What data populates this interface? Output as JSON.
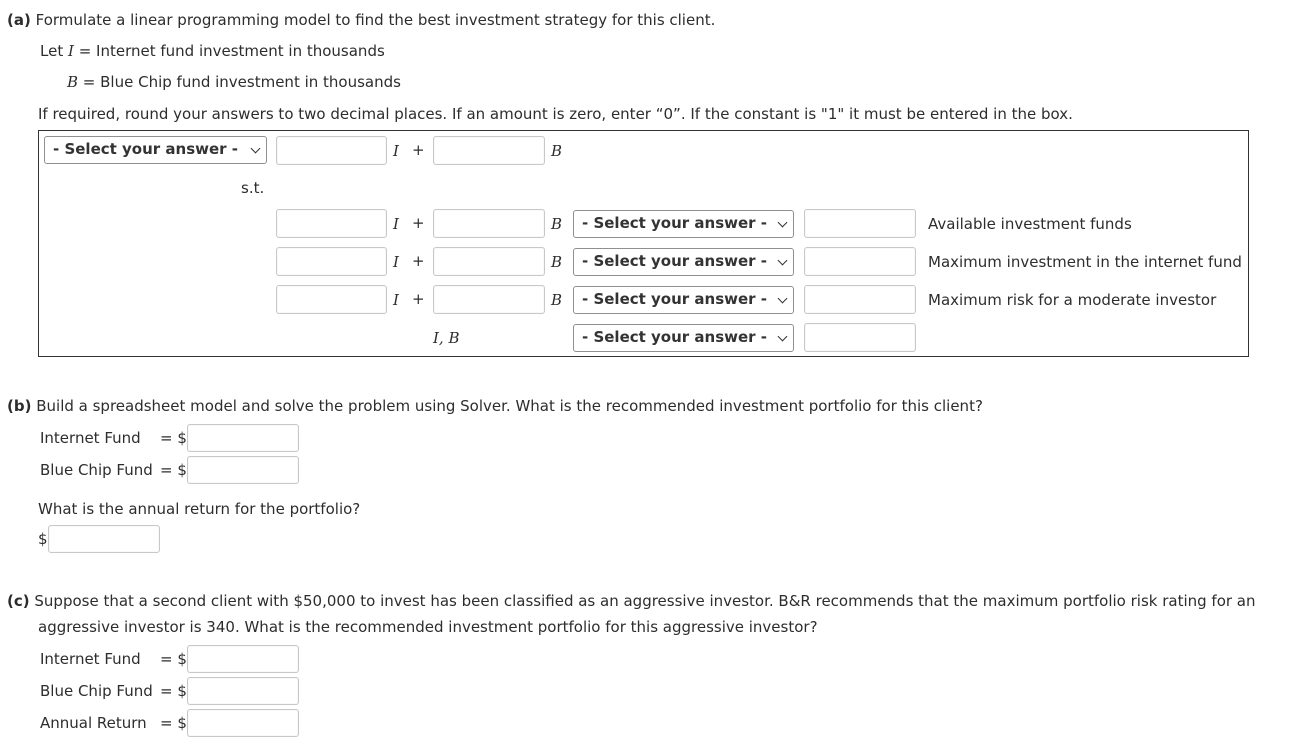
{
  "part_a": {
    "label": "(a)",
    "question": "Formulate a linear programming model to find the best investment strategy for this client.",
    "let_prefix": "Let ",
    "var_i": "I",
    "var_i_def": " = Internet fund investment in thousands",
    "var_b": "B",
    "var_b_def": " = Blue Chip fund investment in thousands",
    "instructions": "If required, round your answers to two decimal places. If an amount is zero, enter “0”. If the constant is \"1\" it must be entered in the box.",
    "select_placeholder": "- Select your answer -",
    "objective": {
      "select_value": "- Select your answer -",
      "coef_i": "",
      "coef_b": "",
      "i_symbol": "I",
      "plus": "+",
      "b_symbol": "B"
    },
    "st_label": "s.t.",
    "constraints": [
      {
        "coef_i": "",
        "coef_b": "",
        "i_symbol": "I",
        "plus": "+",
        "b_symbol": "B",
        "relation": "- Select your answer -",
        "rhs": "",
        "description": "Available investment funds"
      },
      {
        "coef_i": "",
        "coef_b": "",
        "i_symbol": "I",
        "plus": "+",
        "b_symbol": "B",
        "relation": "- Select your answer -",
        "rhs": "",
        "description": "Maximum investment in the internet fund"
      },
      {
        "coef_i": "",
        "coef_b": "",
        "i_symbol": "I",
        "plus": "+",
        "b_symbol": "B",
        "relation": "- Select your answer -",
        "rhs": "",
        "description": "Maximum risk for a moderate investor"
      }
    ],
    "nonneg": {
      "vars": "I, B",
      "relation": "- Select your answer -",
      "rhs": ""
    }
  },
  "part_b": {
    "label": "(b)",
    "question": "Build a spreadsheet model and solve the problem using Solver. What is the recommended investment portfolio for this client?",
    "internet_label": "Internet Fund",
    "blue_chip_label": "Blue Chip Fund",
    "equals_dollar": "= $",
    "internet_value": "",
    "blue_chip_value": "",
    "return_question": "What is the annual return for the portfolio?",
    "dollar": "$",
    "return_value": ""
  },
  "part_c": {
    "label": "(c)",
    "question_line1": "Suppose that a second client with $50,000 to invest has been classified as an aggressive investor. B&R recommends that the maximum portfolio risk rating for an",
    "question_line2": "aggressive investor is 340. What is the recommended investment portfolio for this aggressive investor?",
    "internet_label": "Internet Fund",
    "blue_chip_label": "Blue Chip Fund",
    "return_label": "Annual Return",
    "equals_dollar": "= $",
    "internet_value": "",
    "blue_chip_value": "",
    "return_value": ""
  }
}
